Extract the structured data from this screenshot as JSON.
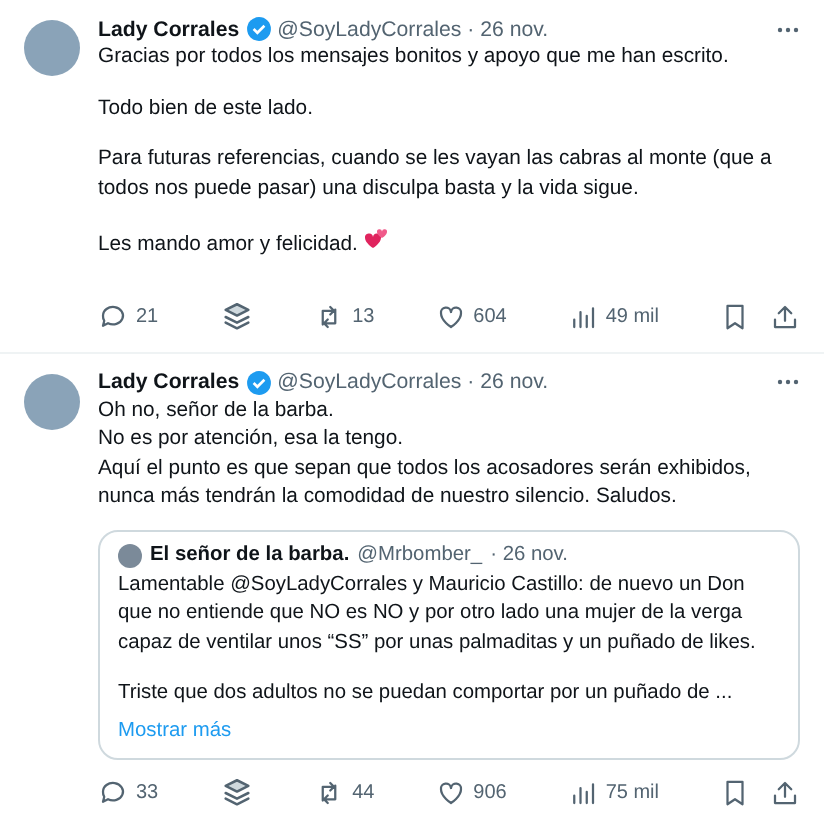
{
  "tweets": [
    {
      "author": "Lady Corrales",
      "handle": "@SoyLadyCorrales",
      "date": "· 26 nov.",
      "verified": true,
      "paragraphs": [
        "Gracias por todos los mensajes bonitos y apoyo que me han escrito.",
        "Todo bien de este lado.",
        "Para futuras referencias, cuando se les vayan las cabras al monte (que a todos nos puede pasar) una disculpa basta y la vida sigue.",
        "Les mando amor y felicidad."
      ],
      "heart_emoji": true,
      "replies": "21",
      "reposts": "13",
      "likes": "604",
      "views": "49 mil"
    },
    {
      "author": "Lady Corrales",
      "handle": "@SoyLadyCorrales",
      "date": "· 26 nov.",
      "verified": true,
      "lines": [
        "Oh no, señor de la barba.",
        "No es por atención, esa la tengo.",
        "Aquí el punto es que sepan que todos los acosadores serán exhibidos, nunca más tendrán la comodidad de nuestro silencio. Saludos."
      ],
      "quote": {
        "author": "El señor de la barba.",
        "handle": "@Mrbomber_",
        "date": "· 26 nov.",
        "paragraphs": [
          "Lamentable @SoyLadyCorrales y Mauricio Castillo: de nuevo un Don que no entiende que NO es NO y por otro lado una mujer de la verga capaz de ventilar unos “SS” por unas palmaditas y un puñado de likes.",
          "Triste que dos adultos no se puedan comportar por un puñado de ..."
        ],
        "show_more": "Mostrar más"
      },
      "replies": "33",
      "reposts": "44",
      "likes": "906",
      "views": "75 mil"
    }
  ]
}
